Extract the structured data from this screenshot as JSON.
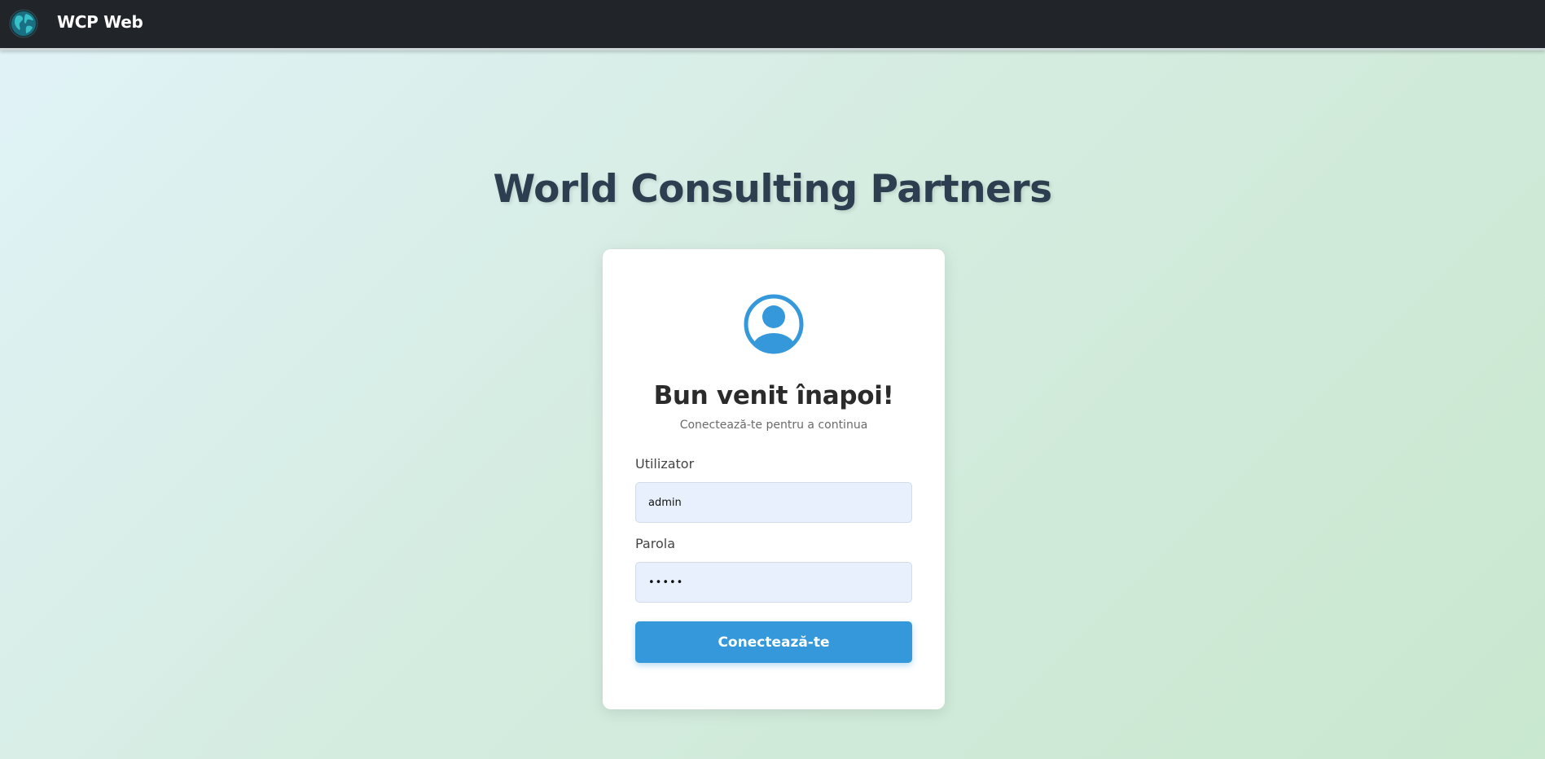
{
  "navbar": {
    "brand_name": "WCP Web",
    "logo_icon": "globe-icon",
    "background_color": "#212429"
  },
  "page": {
    "title": "World Consulting Partners"
  },
  "login": {
    "avatar_icon": "user-circle-icon",
    "welcome_title": "Bun venit înapoi!",
    "welcome_subtitle": "Conectează-te pentru a continua",
    "username_label": "Utilizator",
    "username_value": "admin",
    "password_label": "Parola",
    "password_value": "admin",
    "submit_label": "Conectează-te",
    "accent_color": "#3498db"
  }
}
